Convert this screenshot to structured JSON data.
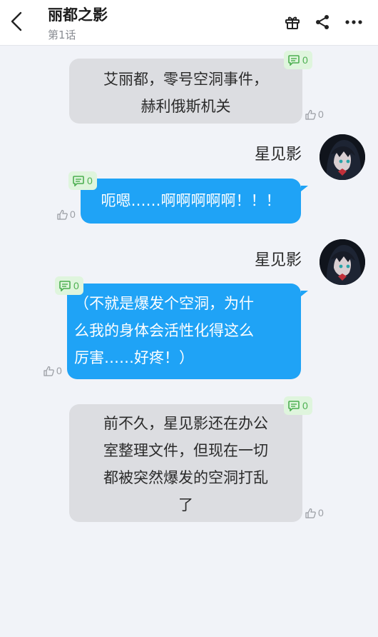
{
  "header": {
    "title": "丽都之影",
    "subtitle": "第1话"
  },
  "messages": [
    {
      "text_lines": [
        "艾丽都，零号空洞事件，",
        "赫利俄斯机关"
      ],
      "comments": "0",
      "likes": "0"
    },
    {
      "speaker": "星见影",
      "text_lines": [
        "呃嗯……啊啊啊啊啊！！！"
      ],
      "comments": "0",
      "likes": "0"
    },
    {
      "speaker": "星见影",
      "text_lines": [
        "（不就是爆发个空洞，为什",
        "么我的身体会活性化得这么",
        "厉害……好疼！）"
      ],
      "comments": "0",
      "likes": "0"
    },
    {
      "text_lines": [
        "前不久，星见影还在办公",
        "室整理文件，但现在一切",
        "都被突然爆发的空洞打乱",
        "了"
      ],
      "comments": "0",
      "likes": "0"
    }
  ],
  "colors": {
    "accent_blue": "#1fa3f6",
    "left_bubble": "#dcdde1",
    "badge_green": "#4caf50"
  },
  "icons": [
    "back-arrow-icon",
    "gift-icon",
    "share-icon",
    "more-icon",
    "comment-icon",
    "thumbs-up-icon"
  ]
}
